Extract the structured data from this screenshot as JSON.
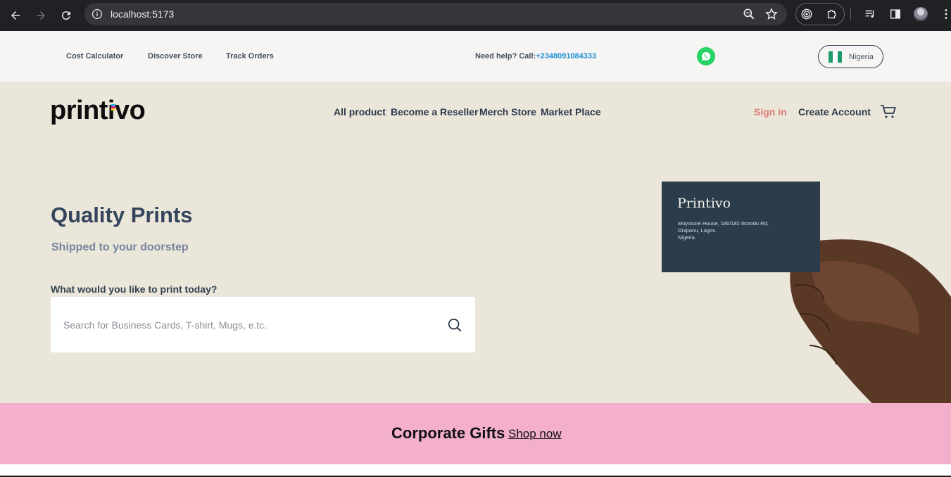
{
  "browser": {
    "url": "localhost:5173"
  },
  "topbar": {
    "links": [
      "Cost Calculator",
      "Discover Store",
      "Track Orders"
    ],
    "help_text": "Need help? Call:",
    "phone": "+2348091084333",
    "country": "Nigeria"
  },
  "header": {
    "logo": "printivo",
    "nav": [
      "All product",
      "Become a Reseller",
      "Merch Store",
      "Market Place"
    ],
    "sign_in": "Sign in",
    "create_account": "Create Account"
  },
  "hero": {
    "title": "Quality Prints",
    "subtitle": "Shipped to your doorstep",
    "search_label": "What would you like to print today?",
    "search_placeholder": "Search for Business Cards, T-shirt, Mugs, e.tc.",
    "card_brand": "Printivo",
    "card_address_line1": "Moyosore House, 180/182 Ikorodu Rd,",
    "card_address_line2": "Onipanu, Lagos.",
    "card_address_line3": "Nigeria."
  },
  "promo": {
    "title": "Corporate Gifts",
    "link": "Shop now"
  },
  "colors": {
    "hero_bg": "#ebe6da",
    "topbar_bg": "#f6f5f3",
    "promo_bg": "#f3afcc",
    "sign_in": "#d97a75",
    "phone": "#1e8fd6",
    "card": "#2b3c4b"
  }
}
